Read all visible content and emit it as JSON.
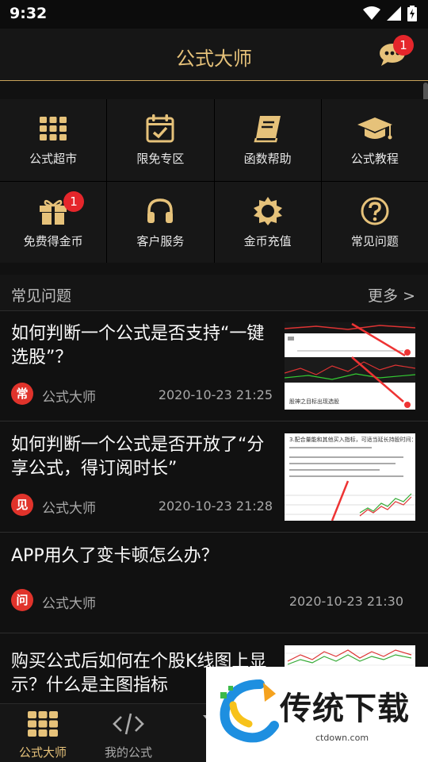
{
  "status_bar": {
    "time": "9:32"
  },
  "header": {
    "title": "公式大师",
    "message_badge": "1"
  },
  "menu": [
    {
      "label": "公式超市",
      "icon": "grid-icon"
    },
    {
      "label": "限免专区",
      "icon": "calendar-check-icon"
    },
    {
      "label": "函数帮助",
      "icon": "book-icon"
    },
    {
      "label": "公式教程",
      "icon": "graduation-cap-icon"
    },
    {
      "label": "免费得金币",
      "icon": "gift-icon",
      "badge": "1"
    },
    {
      "label": "客户服务",
      "icon": "headset-icon"
    },
    {
      "label": "金币充值",
      "icon": "sun-icon"
    },
    {
      "label": "常见问题",
      "icon": "question-circle-icon"
    }
  ],
  "faq": {
    "title": "常见问题",
    "more": "更多 >",
    "items": [
      {
        "title": "如何判断一个公式是否支持“一键选股”？",
        "tag": "常",
        "author": "公式大师",
        "date": "2020-10-23 21:25",
        "thumb_caption": "股神之目标出现选股"
      },
      {
        "title": "如何判断一个公式是否开放了“分享公式，得订阅时长”",
        "tag": "见",
        "author": "公式大师",
        "date": "2020-10-23 21:28",
        "thumb_caption": "3.配合量能和其他买入指标，可适当延长持股时间："
      },
      {
        "title": "APP用久了变卡顿怎么办？",
        "tag": "问",
        "author": "公式大师",
        "date": "2020-10-23 21:30"
      },
      {
        "title": "购买公式后如何在个股K线图上显示？什么是主图指标",
        "tag": "",
        "author": "",
        "date": ""
      }
    ]
  },
  "bottom_nav": [
    {
      "label": "公式大师",
      "icon": "grid-icon",
      "active": true
    },
    {
      "label": "我的公式",
      "icon": "code-icon",
      "active": false
    },
    {
      "label": "自",
      "icon": "filter-icon",
      "active": false
    }
  ],
  "watermark": {
    "text": "传统下载",
    "url": "ctdown.com"
  },
  "colors": {
    "accent": "#e6c27a",
    "badge": "#e5262b",
    "background": "#111111"
  }
}
